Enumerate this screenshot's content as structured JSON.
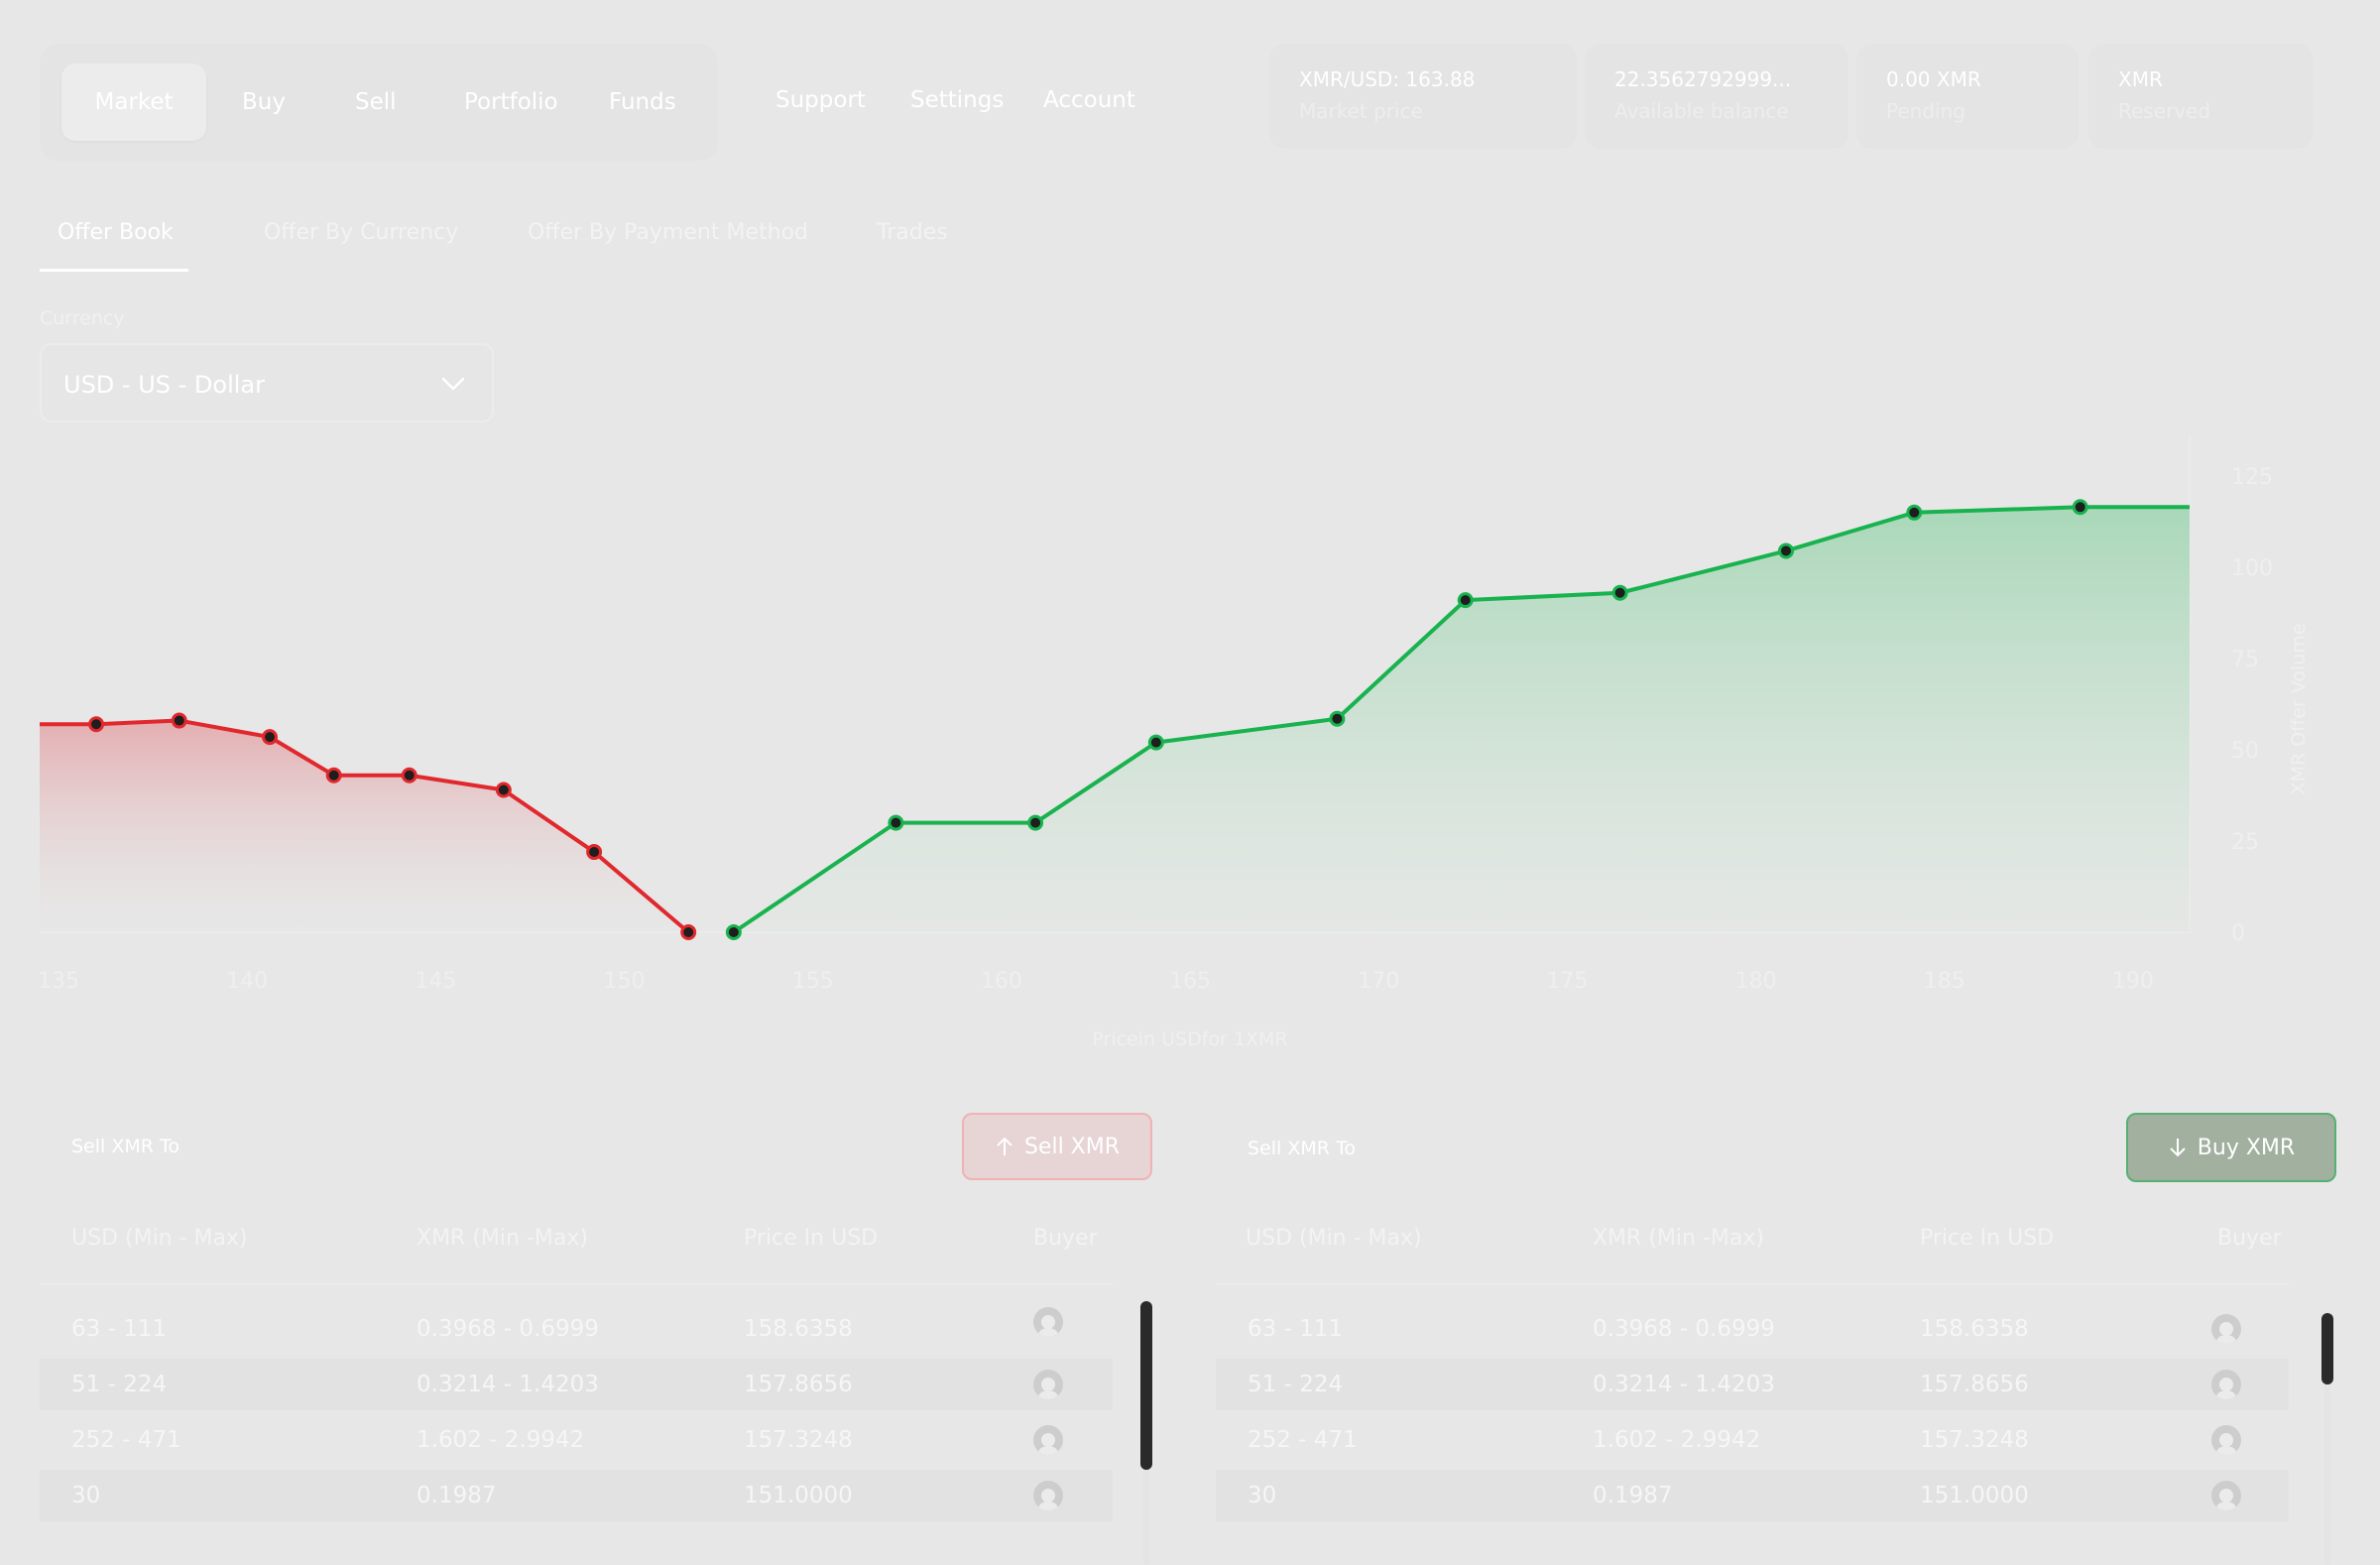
{
  "nav": {
    "items": [
      "Market",
      "Buy",
      "Sell",
      "Portfolio",
      "Funds"
    ],
    "secondary": [
      "Support",
      "Settings",
      "Account"
    ]
  },
  "stats": [
    {
      "value": "XMR/USD: 163.88",
      "label": "Market price"
    },
    {
      "value": "22.3562792999...",
      "label": "Available balance"
    },
    {
      "value": "0.00 XMR",
      "label": "Pending"
    },
    {
      "value": "XMR",
      "label": "Reserved"
    }
  ],
  "tabs": [
    "Offer Book",
    "Offer By Currency",
    "Offer By Payment Method",
    "Trades"
  ],
  "currency": {
    "label": "Currency",
    "value": "USD - US - Dollar"
  },
  "chart_data": {
    "type": "area",
    "xlabel": "Pricein USDfor 1XMR",
    "ylabel": "XMR Offer Volume",
    "xlim": [
      134.5,
      191.5
    ],
    "ylim": [
      0,
      125
    ],
    "xticks": [
      135,
      140,
      145,
      150,
      155,
      160,
      165,
      170,
      175,
      180,
      185,
      190
    ],
    "yticks": [
      0,
      25,
      50,
      75,
      100,
      125
    ],
    "series": [
      {
        "side": "sell",
        "color": "#e0282d",
        "x": [
          136,
          138.2,
          140.6,
          142.3,
          144.3,
          146.8,
          149.2,
          151.7
        ],
        "y": [
          57,
          58,
          53.5,
          43,
          43,
          39,
          22,
          0
        ],
        "x_start": 134.5,
        "y_start": 57
      },
      {
        "side": "buy",
        "color": "#18b24e",
        "x": [
          152.9,
          157.2,
          160.9,
          164.1,
          168.9,
          172.3,
          176.4,
          180.8,
          184.2,
          188.6
        ],
        "y": [
          0,
          30,
          30,
          52,
          58.5,
          91,
          93,
          104.5,
          115,
          116.5
        ],
        "x_end": 191.5,
        "y_end": 116.5
      }
    ]
  },
  "sell_panel": {
    "title": "Sell XMR To",
    "button": "Sell XMR",
    "columns": [
      "USD (Min - Max)",
      "XMR (Min -Max)",
      "Price In USD",
      "Buyer"
    ],
    "rows": [
      [
        "63 - 111",
        "0.3968 - 0.6999",
        "158.6358"
      ],
      [
        "51 - 224",
        "0.3214 - 1.4203",
        "157.8656"
      ],
      [
        "252 - 471",
        "1.602 - 2.9942",
        "157.3248"
      ],
      [
        "30",
        "0.1987",
        "151.0000"
      ]
    ]
  },
  "buy_panel": {
    "title": "Sell XMR To",
    "button": "Buy XMR",
    "columns": [
      "USD (Min - Max)",
      "XMR (Min -Max)",
      "Price In USD",
      "Buyer"
    ],
    "rows": [
      [
        "63 - 111",
        "0.3968 - 0.6999",
        "158.6358"
      ],
      [
        "51 - 224",
        "0.3214 - 1.4203",
        "157.8656"
      ],
      [
        "252 - 471",
        "1.602 - 2.9942",
        "157.3248"
      ],
      [
        "30",
        "0.1987",
        "151.0000"
      ]
    ]
  }
}
